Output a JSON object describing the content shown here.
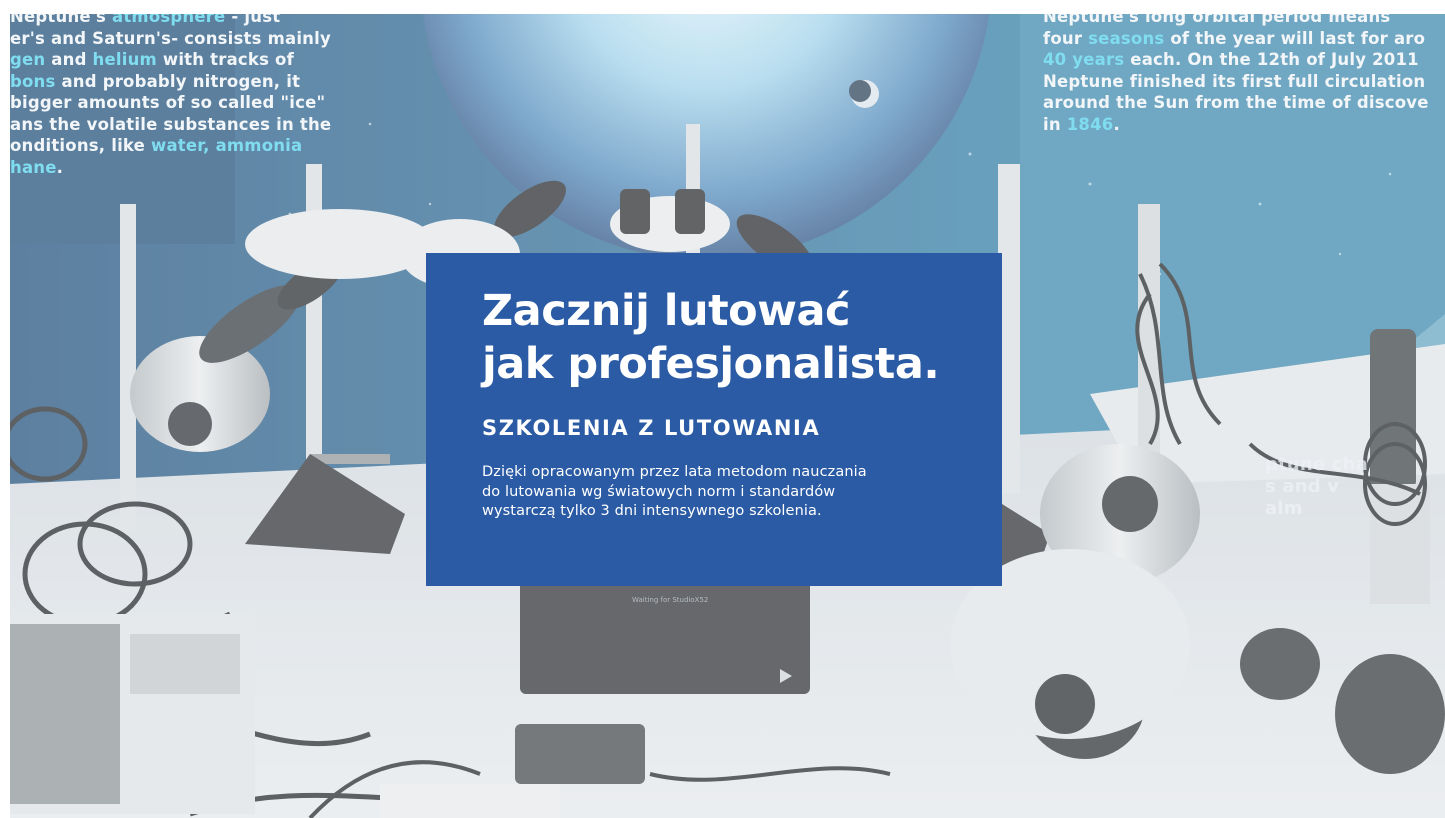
{
  "hero": {
    "title_line1": "Zacznij lutować",
    "title_line2": "jak profesjonalista.",
    "subtitle": "SZKOLENIA Z LUTOWANIA",
    "description_line1": "Dzięki opracowanym przez lata metodom nauczania",
    "description_line2": "do lutowania wg światowych norm i standardów",
    "description_line3": "wystarczą tylko 3 dni intensywnego szkolenia.",
    "card_color": "#2a5ba4"
  },
  "background": {
    "left_poster": [
      "Neptune's atmosphere - just",
      "er's and Saturn's- consists mainly",
      "gen and helium with tracks of",
      "bons and probably nitrogen, it",
      "bigger amounts of so called \"ice\"",
      "ans the volatile substances in the",
      "onditions, like water, ammonia",
      "hane."
    ],
    "right_poster": [
      "Neptune's long orbital period means",
      "four seasons of the year will last for aro",
      "40 years each. On the 12th of July 2011",
      "Neptune finished its first full circulation",
      "around the Sun from the time of discove",
      "in 1846."
    ],
    "right_poster_lower": [
      "ptune cha",
      "s and v",
      "alm"
    ],
    "device_screen_text": "Waiting for StudioX52",
    "accent_color": "#4fd0ea"
  }
}
